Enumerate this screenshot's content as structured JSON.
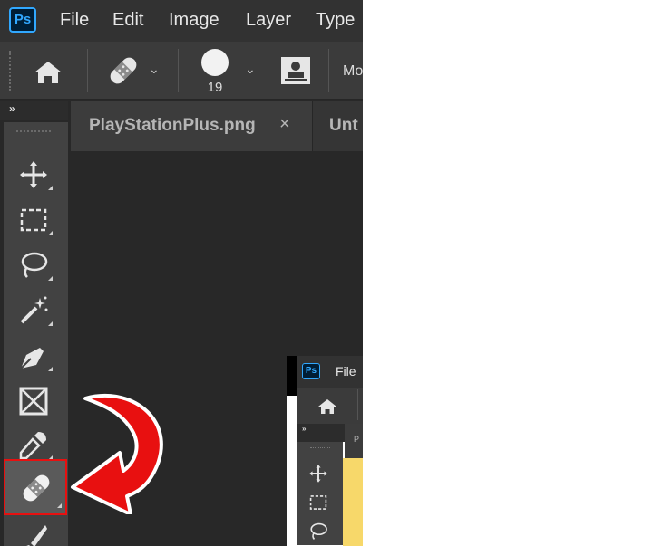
{
  "app": {
    "logo_text": "Ps",
    "menu": [
      "File",
      "Edit",
      "Image",
      "Layer",
      "Type"
    ]
  },
  "options_bar": {
    "brush_size": "19",
    "mode_label_partial": "Mo"
  },
  "tabs": [
    {
      "label": "PlayStationPlus.png",
      "close": "×"
    },
    {
      "label": "Unt"
    }
  ],
  "toolbar": {
    "collapse_glyph": "»",
    "tools": [
      "move-tool",
      "marquee-tool",
      "lasso-tool",
      "magic-wand-tool",
      "pen-tool",
      "frame-tool",
      "eyedropper-tool",
      "spot-healing-brush-tool",
      "brush-tool"
    ],
    "selected": "spot-healing-brush-tool"
  },
  "thumbnail": {
    "logo_text": "Ps",
    "menu_item": "File",
    "collapse_glyph": "»",
    "tab_letter": "P"
  },
  "colors": {
    "annotation": "#e81010",
    "ps_blue": "#31a8ff",
    "thumb_yellow": "#f7d86a"
  }
}
